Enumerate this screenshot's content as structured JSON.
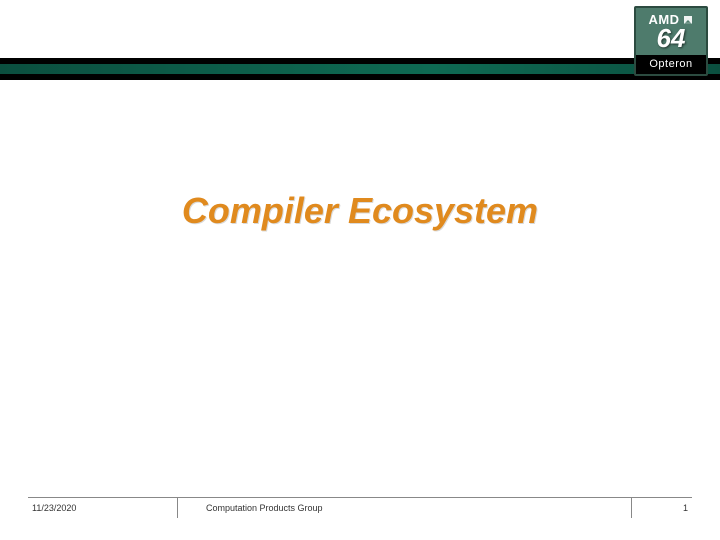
{
  "logo": {
    "brand": "AMD",
    "number": "64",
    "product": "Opteron"
  },
  "title": "Compiler Ecosystem",
  "footer": {
    "date": "11/23/2020",
    "group": "Computation Products Group",
    "page": "1"
  }
}
